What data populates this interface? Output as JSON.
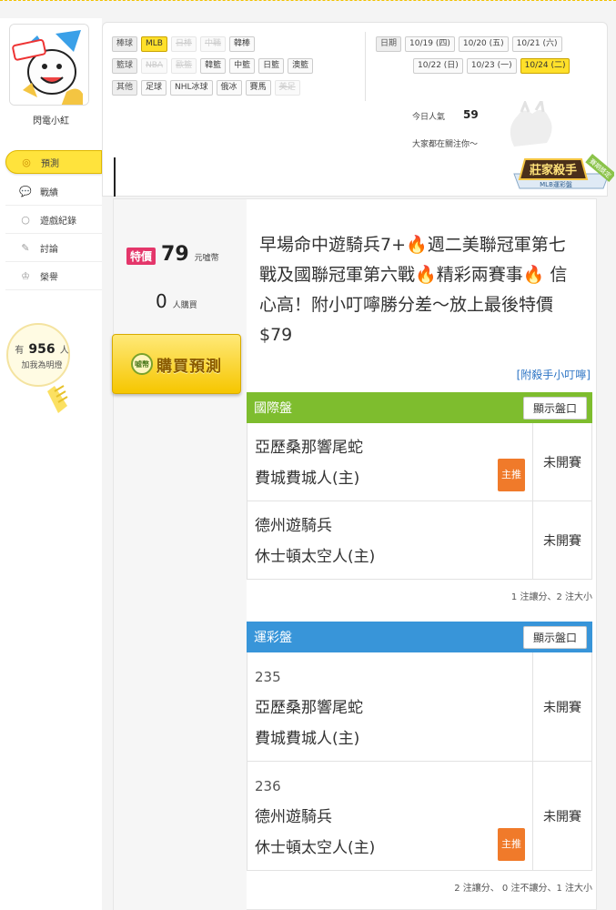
{
  "user": {
    "name": "閃電小紅"
  },
  "sidebar": {
    "items": [
      {
        "label": "預測",
        "icon": "target-icon",
        "active": true
      },
      {
        "label": "戰績",
        "icon": "chat-bubble-icon"
      },
      {
        "label": "遊戲紀錄",
        "icon": "circle-icon"
      },
      {
        "label": "討論",
        "icon": "edit-icon"
      },
      {
        "label": "榮譽",
        "icon": "medal-icon"
      }
    ],
    "bulb": {
      "prefix": "有",
      "count": "956",
      "suffix": "人",
      "cta": "加我為明燈"
    }
  },
  "filters": {
    "baseball": {
      "category": "棒球",
      "items": [
        {
          "label": "MLB",
          "state": "selected"
        },
        {
          "label": "日棒",
          "state": "disabled"
        },
        {
          "label": "中職",
          "state": "disabled"
        },
        {
          "label": "韓棒",
          "state": "normal"
        }
      ]
    },
    "basketball": {
      "category": "籃球",
      "items": [
        {
          "label": "NBA",
          "state": "disabled"
        },
        {
          "label": "歐籃",
          "state": "disabled"
        },
        {
          "label": "韓籃",
          "state": "normal"
        },
        {
          "label": "中籃",
          "state": "normal"
        },
        {
          "label": "日籃",
          "state": "normal"
        },
        {
          "label": "澳籃",
          "state": "normal"
        }
      ]
    },
    "other": {
      "category": "其他",
      "items": [
        {
          "label": "足球",
          "state": "normal"
        },
        {
          "label": "NHL冰球",
          "state": "normal"
        },
        {
          "label": "俄冰",
          "state": "normal"
        },
        {
          "label": "賽馬",
          "state": "normal"
        },
        {
          "label": "美足",
          "state": "disabled"
        }
      ]
    },
    "dates": {
      "category": "日期",
      "row1": [
        "10/19 (四)",
        "10/20 (五)",
        "10/21 (六)"
      ],
      "row2": [
        "10/22 (日)",
        "10/23 (一)",
        "10/24 (二)"
      ],
      "selected": "10/24 (二)"
    }
  },
  "stats": {
    "popularity_label": "今日人氣",
    "popularity_value": "59",
    "follow_text": "大家都在關注你～"
  },
  "badge": {
    "main": "莊家殺手",
    "sub": "MLB運彩盤",
    "ribbon": "賽期獎定"
  },
  "offer": {
    "price_tag": "特價",
    "price": "79",
    "price_unit": "元噓幣",
    "buyers": "0",
    "buyers_unit": "人購買",
    "buy_label": "購買預測",
    "coin_label": "噓幣",
    "title_segments": [
      "早場命中遊騎兵7+",
      "🔥",
      "週二美聯冠軍第七戰及國聯冠軍第六戰",
      "🔥",
      "精彩兩賽事",
      "🔥",
      " 信心高！附小叮嚀勝分差～放上最後特價$79"
    ],
    "link": "[附殺手小叮嚀]"
  },
  "markets": [
    {
      "name": "國際盤",
      "show_label": "顯示盤口",
      "color": "#7ebd2e",
      "games": [
        {
          "number": "",
          "team1": "亞歷桑那響尾蛇",
          "team2": "費城費城人(主)",
          "status": "未開賽",
          "recommend": "主推"
        },
        {
          "number": "",
          "team1": "德州遊騎兵",
          "team2": "休士頓太空人(主)",
          "status": "未開賽",
          "recommend": ""
        }
      ],
      "note": "1 注讓分、2 注大小"
    },
    {
      "name": "運彩盤",
      "show_label": "顯示盤口",
      "color": "#3895d9",
      "games": [
        {
          "number": "235",
          "team1": "亞歷桑那響尾蛇",
          "team2": "費城費城人(主)",
          "status": "未開賽",
          "recommend": ""
        },
        {
          "number": "236",
          "team1": "德州遊騎兵",
          "team2": "休士頓太空人(主)",
          "status": "未開賽",
          "recommend": "主推"
        }
      ],
      "note": "2 注讓分、 0 注不讓分、1 注大小"
    }
  ]
}
